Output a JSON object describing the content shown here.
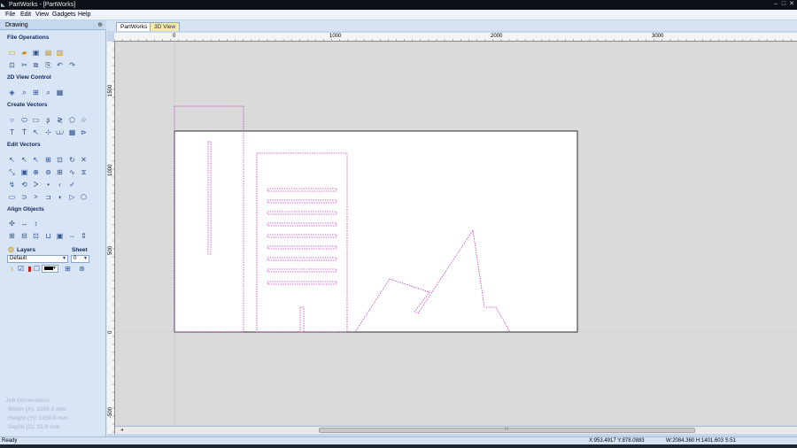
{
  "window": {
    "title": "PartWorks - [PartWorks]",
    "app_icon": "partworks-logo-icon",
    "minimize": "–",
    "maximize": "□",
    "close": "✕"
  },
  "menubar": {
    "items": [
      {
        "label": "File"
      },
      {
        "label": "Edit"
      },
      {
        "label": "View"
      },
      {
        "label": "Gadgets"
      },
      {
        "label": "Help"
      }
    ]
  },
  "left_panel": {
    "title": "Drawing",
    "pin_icon": "pin-icon",
    "pin_glyph": "⊕",
    "sections": {
      "file_operations": "File Operations",
      "view_control": "2D View Control",
      "create_vectors": "Create Vectors",
      "edit_vectors": "Edit Vectors",
      "align_objects": "Align Objects"
    },
    "layers": {
      "label": "Layers",
      "sheet_label": "Sheet",
      "layer_value": "Default",
      "sheet_value": "0"
    },
    "job_dimensions": {
      "title": "Job Dimensions",
      "width": "Width  (X): 2500.0 mm",
      "height": "Height (Y): 1250.0 mm",
      "depth": "Depth  (Z): 15.0 mm"
    }
  },
  "tabs": [
    {
      "label": "PartWorks",
      "active": true
    },
    {
      "label": "3D View",
      "active": false
    }
  ],
  "rulers": {
    "top_labels": [
      "0",
      "1000",
      "2000",
      "3000"
    ],
    "left_labels": [
      "1500",
      "1000",
      "500",
      "0",
      "-500"
    ]
  },
  "statusbar": {
    "ready": "Ready",
    "cursor": "X:953.4917 Y:878.0883",
    "selection": "W:2084.360  H:1401.603  S:51"
  },
  "colors": {
    "vector_stroke": "#c23fc0",
    "panel_bg": "#d8e5f5",
    "canvas_bg": "#dadada",
    "material": "#ffffff"
  }
}
